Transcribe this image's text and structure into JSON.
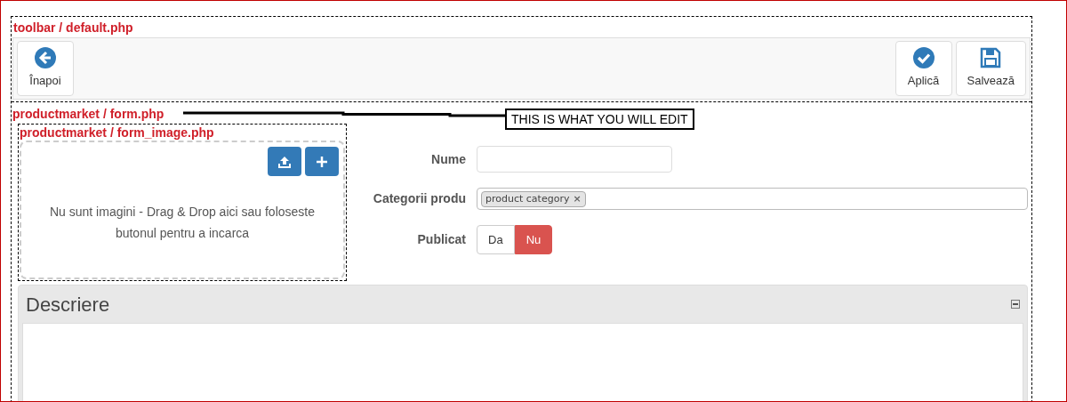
{
  "toolbar": {
    "label": "toolbar / default.php",
    "buttons": [
      {
        "kind": "back",
        "label": "Înapoi"
      },
      {
        "kind": "apply",
        "label": "Aplică"
      },
      {
        "kind": "save",
        "label": "Salvează"
      }
    ]
  },
  "form": {
    "label": "productmarket / form.php",
    "callout": "THIS IS WHAT YOU WILL EDIT",
    "image": {
      "label": "productmarket / form_image.php",
      "message": "Nu sunt imagini - Drag & Drop aici sau foloseste butonul pentru a incarca",
      "buttons": [
        {
          "kind": "upload"
        },
        {
          "kind": "add"
        }
      ]
    },
    "fields": [
      {
        "kind": "text",
        "label": "Nume"
      },
      {
        "kind": "tags",
        "label": "Categorii produ",
        "tags": [
          "product category"
        ],
        "remove": "×"
      },
      {
        "kind": "toggle",
        "label": "Publicat",
        "options": [
          {
            "label": "Da",
            "selected": false
          },
          {
            "label": "Nu",
            "selected": true
          }
        ]
      }
    ],
    "panel": {
      "title": "Descriere",
      "expanded": true
    }
  }
}
